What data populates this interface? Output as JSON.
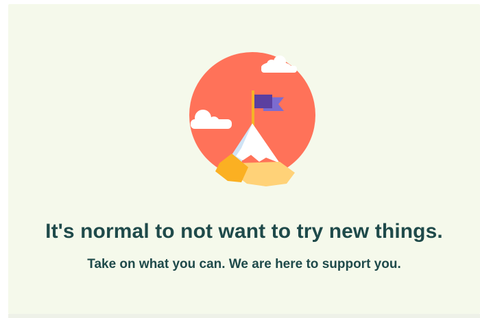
{
  "message": {
    "headline": "It's normal to not want to try new things.",
    "subline": "Take on what you can. We are here to support you."
  },
  "illustration": {
    "icon": "mountain-flag-illustration",
    "colors": {
      "sun": "#ff7259",
      "cloud": "#ffffff",
      "flag": "#5b3fa0",
      "flag_tail": "#7c6cd0",
      "pole": "#f5b427",
      "snow": "#ffffff",
      "ice": "#cfe3f5",
      "rock_left": "#fbb022",
      "rock_right": "#ffd278"
    }
  },
  "theme": {
    "background": "#f5f9eb",
    "text": "#1f4a4a"
  }
}
